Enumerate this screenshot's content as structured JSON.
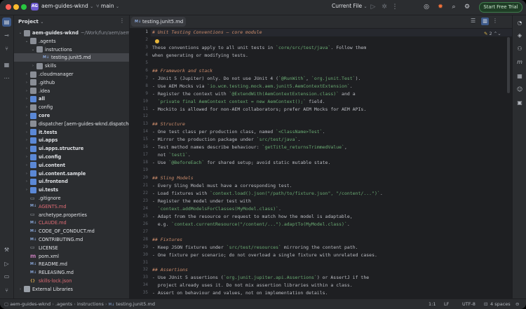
{
  "titlebar": {
    "project_badge": "AG",
    "project_name": "aem-guides-wknd",
    "branch": "main",
    "run_config": "Current File",
    "trial_button": "Start Free Trial"
  },
  "project_panel": {
    "title": "Project",
    "items": [
      {
        "label": "aem-guides-wknd",
        "hint": "~/Work/fun/aem/aem-gu",
        "kind": "root",
        "depth": 0,
        "expanded": true
      },
      {
        "label": ".agents",
        "kind": "folder",
        "depth": 1,
        "expanded": true
      },
      {
        "label": "instructions",
        "kind": "folder",
        "depth": 2,
        "expanded": true
      },
      {
        "label": "testing.junit5.md",
        "kind": "md",
        "depth": 3,
        "selected": true
      },
      {
        "label": "skills",
        "kind": "folder",
        "depth": 2,
        "expanded": false
      },
      {
        "label": ".cloudmanager",
        "kind": "folder",
        "depth": 1,
        "expanded": false
      },
      {
        "label": ".github",
        "kind": "folder",
        "depth": 1,
        "expanded": false
      },
      {
        "label": ".idea",
        "kind": "folder",
        "depth": 1,
        "expanded": false
      },
      {
        "label": "all",
        "kind": "module",
        "depth": 1,
        "expanded": false
      },
      {
        "label": "config",
        "kind": "folder",
        "depth": 1,
        "expanded": false
      },
      {
        "label": "core",
        "kind": "module",
        "depth": 1,
        "expanded": false
      },
      {
        "label": "dispatcher [aem-guides-wknd.dispatche",
        "kind": "folder",
        "depth": 1,
        "expanded": false
      },
      {
        "label": "it.tests",
        "kind": "module",
        "depth": 1,
        "expanded": false
      },
      {
        "label": "ui.apps",
        "kind": "module",
        "depth": 1,
        "expanded": false
      },
      {
        "label": "ui.apps.structure",
        "kind": "module",
        "depth": 1,
        "expanded": false
      },
      {
        "label": "ui.config",
        "kind": "module",
        "depth": 1,
        "expanded": false
      },
      {
        "label": "ui.content",
        "kind": "module",
        "depth": 1,
        "expanded": false
      },
      {
        "label": "ui.content.sample",
        "kind": "module",
        "depth": 1,
        "expanded": false
      },
      {
        "label": "ui.frontend",
        "kind": "module",
        "depth": 1,
        "expanded": false
      },
      {
        "label": "ui.tests",
        "kind": "module",
        "depth": 1,
        "expanded": false
      },
      {
        "label": ".gitignore",
        "kind": "file",
        "depth": 1
      },
      {
        "label": "AGENTS.md",
        "kind": "md",
        "depth": 1,
        "color": "#e06c75"
      },
      {
        "label": "archetype.properties",
        "kind": "file",
        "depth": 1
      },
      {
        "label": "CLAUDE.md",
        "kind": "md",
        "depth": 1,
        "color": "#e06c75"
      },
      {
        "label": "CODE_OF_CONDUCT.md",
        "kind": "md",
        "depth": 1
      },
      {
        "label": "CONTRIBUTING.md",
        "kind": "md",
        "depth": 1
      },
      {
        "label": "LICENSE",
        "kind": "file",
        "depth": 1
      },
      {
        "label": "pom.xml",
        "kind": "xml",
        "depth": 1
      },
      {
        "label": "README.md",
        "kind": "md",
        "depth": 1
      },
      {
        "label": "RELEASING.md",
        "kind": "md",
        "depth": 1
      },
      {
        "label": "skills-lock.json",
        "kind": "json",
        "depth": 1,
        "color": "#e06c75"
      },
      {
        "label": "External Libraries",
        "kind": "lib",
        "depth": 0,
        "expanded": false
      }
    ]
  },
  "editor": {
    "tab_label": "testing.junit5.md",
    "inspection": "2",
    "lines": [
      {
        "n": "1",
        "text": "# Unit Testing Conventions — core module",
        "style": "h1"
      },
      {
        "n": "2",
        "text": ""
      },
      {
        "n": "3",
        "text": "These conventions apply to all unit tests in `core/src/test/java`. Follow them"
      },
      {
        "n": "4",
        "text": "when generating or modifying tests."
      },
      {
        "n": "5",
        "text": ""
      },
      {
        "n": "6",
        "text": "## Framework and stack",
        "style": "h"
      },
      {
        "n": "7",
        "text": "- JUnit 5 (Jupiter) only. Do not use JUnit 4 (`@RunWith`, `org.junit.Test`)."
      },
      {
        "n": "8",
        "text": "- Use AEM Mocks via `io.wcm.testing.mock.aem.junit5.AemContextExtension`."
      },
      {
        "n": "9",
        "text": "- Register the context with `@ExtendWith(AemContextExtension.class)` and a"
      },
      {
        "n": "10",
        "text": "  `private final AemContext context = new AemContext();` field."
      },
      {
        "n": "11",
        "text": "- Mockito is allowed for non-AEM collaborators; prefer AEM Mocks for AEM APIs."
      },
      {
        "n": "12",
        "text": ""
      },
      {
        "n": "13",
        "text": "## Structure",
        "style": "h"
      },
      {
        "n": "14",
        "text": "- One test class per production class, named `<ClassName>Test`."
      },
      {
        "n": "15",
        "text": "- Mirror the production package under `src/test/java`."
      },
      {
        "n": "16",
        "text": "- Test method names describe behaviour: `getTitle_returnsTrimmedValue`,"
      },
      {
        "n": "17",
        "text": "  not `test1`."
      },
      {
        "n": "18",
        "text": "- Use `@BeforeEach` for shared setup; avoid static mutable state."
      },
      {
        "n": "19",
        "text": ""
      },
      {
        "n": "20",
        "text": "## Sling Models",
        "style": "h"
      },
      {
        "n": "21",
        "text": "- Every Sling Model must have a corresponding test."
      },
      {
        "n": "22",
        "text": "- Load fixtures with `context.load().json(\"/path/to/fixture.json\", \"/content/...\")`."
      },
      {
        "n": "23",
        "text": "- Register the model under test with"
      },
      {
        "n": "24",
        "text": "  `context.addModelsForClasses(MyModel.class)`."
      },
      {
        "n": "25",
        "text": "- Adapt from the resource or request to match how the model is adaptable,"
      },
      {
        "n": "26",
        "text": "  e.g. `context.currentResource(\"/content/...\").adaptTo(MyModel.class)`."
      },
      {
        "n": "27",
        "text": ""
      },
      {
        "n": "28",
        "text": "## Fixtures",
        "style": "h"
      },
      {
        "n": "29",
        "text": "- Keep JSON fixtures under `src/test/resources` mirroring the content path."
      },
      {
        "n": "30",
        "text": "- One fixture per scenario; do not overload a single fixture with unrelated cases."
      },
      {
        "n": "31",
        "text": ""
      },
      {
        "n": "32",
        "text": "## Assertions",
        "style": "h"
      },
      {
        "n": "33",
        "text": "- Use JUnit 5 assertions (`org.junit.jupiter.api.Assertions`) or AssertJ if the"
      },
      {
        "n": "34",
        "text": "  project already uses it. Do not mix assertion libraries within a class."
      },
      {
        "n": "35",
        "text": "- Assert on behaviour and values, not on implementation details."
      }
    ]
  },
  "statusbar": {
    "breadcrumb": [
      "aem-guides-wknd",
      ".agents",
      "instructions",
      "testing.junit5.md"
    ],
    "position": "1:1",
    "line_sep": "LF",
    "encoding": "UTF-8",
    "indent": "4 spaces"
  }
}
